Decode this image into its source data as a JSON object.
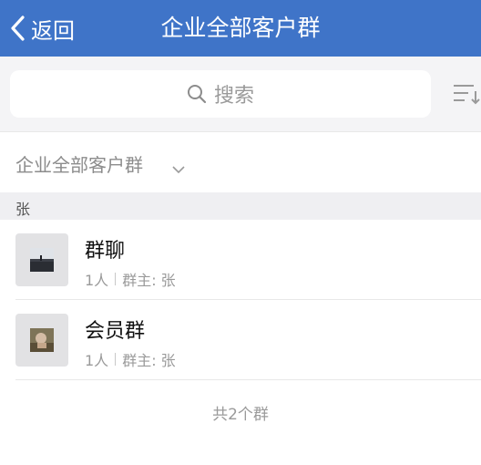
{
  "nav": {
    "back_label": "返回",
    "title": "企业全部客户群"
  },
  "search": {
    "placeholder": "搜索"
  },
  "filter": {
    "selected": "企业全部客户群"
  },
  "section": {
    "letter": "张"
  },
  "groups": [
    {
      "name": "群聊",
      "members": "1人",
      "owner": "群主: 张"
    },
    {
      "name": "会员群",
      "members": "1人",
      "owner": "群主: 张"
    }
  ],
  "footer": {
    "count_text": "共2个群"
  },
  "colors": {
    "accent": "#3f74c8",
    "background": "#f4f4f6"
  }
}
